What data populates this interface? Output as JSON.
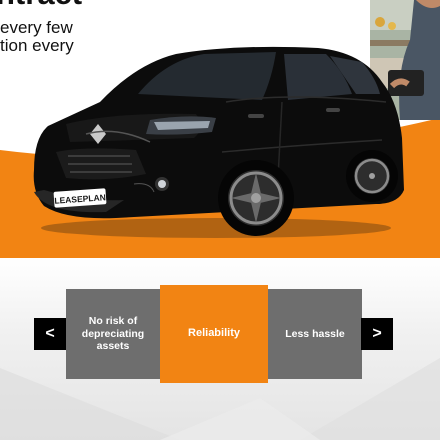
{
  "hero": {
    "headline": "ntract",
    "subline_1": "every few",
    "subline_2": "tion every",
    "plate_text": "LEASEPLAN"
  },
  "carousel": {
    "prev_label": "<",
    "next_label": ">",
    "tiles": [
      {
        "label": "No risk of depreciating assets"
      },
      {
        "label": "Reliability"
      },
      {
        "label": "Less hassle"
      }
    ]
  },
  "colors": {
    "accent_orange": "#f28413",
    "tile_grey": "#6e6e6e"
  }
}
